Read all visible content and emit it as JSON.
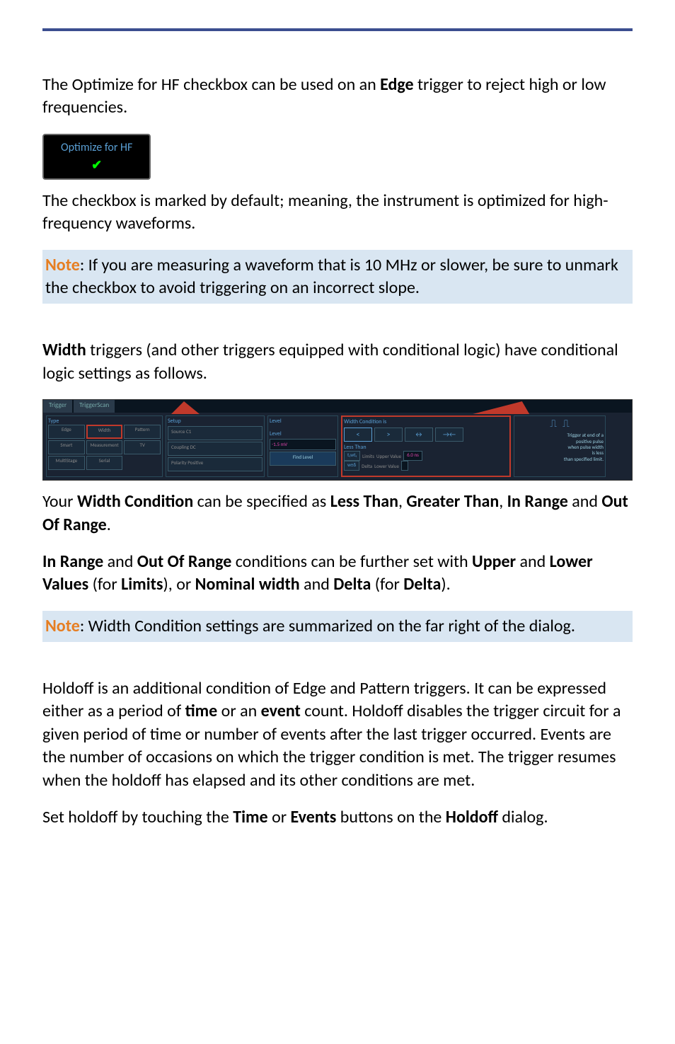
{
  "border_color": "#3b4e8f",
  "intro_text_1a": "The Optimize for HF checkbox can be used on an ",
  "intro_text_1b": " trigger to reject high or low frequencies.",
  "edge_word": "Edge",
  "hf_checkbox": {
    "label": "Optimize for HF",
    "checked": true,
    "check_glyph": "✔"
  },
  "intro_text_2": "The checkbox is marked by default; meaning, the instrument is optimized for high-frequency waveforms.",
  "note_1": {
    "label": "Note",
    "text": ": If you are measuring a waveform that is 10 MHz or slower, be sure to unmark the checkbox to avoid triggering on an incorrect slope."
  },
  "width_intro_a": "Width",
  "width_intro_b": " triggers (and other triggers equipped with conditional logic) have conditional logic settings as follows.",
  "trigger_panel": {
    "tabs": [
      "Trigger",
      "TriggerScan"
    ],
    "type_label": "Type",
    "type_cells": [
      "Edge",
      "Width",
      "Pattern",
      "Smart",
      "Measurement",
      "TV",
      "MultiStage",
      "Serial"
    ],
    "setup_label": "Setup",
    "setup_items": {
      "source": "Source",
      "source_val": "C1",
      "coupling": "Coupling",
      "coupling_val": "DC",
      "polarity": "Polarity",
      "polarity_val": "Positive"
    },
    "level_label": "Level",
    "level_items": {
      "lvl_label": "Level",
      "lvl_value": "-1.5 mV",
      "find_label": "Find\nLevel"
    },
    "condition_label": "Width Condition is",
    "condition_buttons": [
      "<",
      ">",
      "↔",
      "→←"
    ],
    "condition_sel": "Less Than",
    "limits_label": "Limits",
    "delta_label": "Delta",
    "tw_label": "t₁wt₁",
    "wd_label": "w±δ",
    "upper_label": "Upper Value",
    "upper_value": "6.0 ns",
    "lower_label": "Lower Value",
    "lower_value": "",
    "summary_text": "Trigger at end of a\npositive pulse\nwhen pulse width\nis less\nthan specified limit."
  },
  "width_cond_a": "Your ",
  "width_cond_b": "Width Condition",
  "width_cond_c": " can be specified as ",
  "width_cond_d": "Less Than",
  "width_cond_e": ", ",
  "width_cond_f": "Greater Than",
  "width_cond_g": ", ",
  "width_cond_h": "In Range",
  "width_cond_i": " and ",
  "width_cond_j": "Out Of Range",
  "width_cond_k": ".",
  "range_a": "In Range",
  "range_b": " and ",
  "range_c": "Out Of Range",
  "range_d": " conditions can be further set with ",
  "range_e": "Upper",
  "range_f": " and ",
  "range_g": "Lower Values",
  "range_h": " (for ",
  "range_i": "Limits",
  "range_j": "), or ",
  "range_k": "Nominal width",
  "range_l": " and ",
  "range_m": "Delta",
  "range_n": " (for ",
  "range_o": "Delta",
  "range_p": ").",
  "note_2": {
    "label": "Note",
    "text": ": Width Condition settings are summarized on the far right of the dialog."
  },
  "holdoff_1": "Holdoff is an additional condition of Edge and Pattern triggers. It can be expressed either as a period of ",
  "holdoff_2": "time",
  "holdoff_3": " or an ",
  "holdoff_4": "event",
  "holdoff_5": " count. Holdoff disables the trigger circuit for a given period of time or number of events after the last trigger occurred. Events are the number of occasions on which the trigger condition is met. The trigger resumes when the holdoff has elapsed and its other conditions are met.",
  "holdoff_set_a": "Set holdoff by touching the ",
  "holdoff_set_b": "Time",
  "holdoff_set_c": " or ",
  "holdoff_set_d": "Events",
  "holdoff_set_e": " buttons on the ",
  "holdoff_set_f": "Holdoff",
  "holdoff_set_g": " dialog."
}
